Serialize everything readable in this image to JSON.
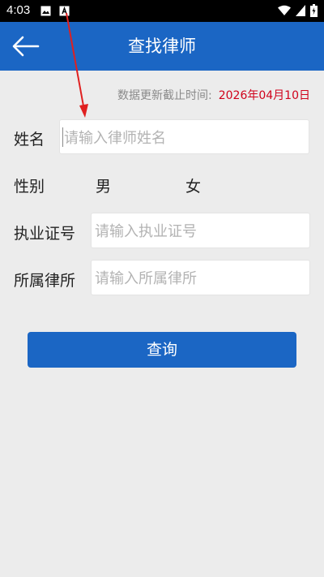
{
  "status_bar": {
    "time": "4:03",
    "icons": [
      "image-icon",
      "text-a-icon",
      "wifi-icon",
      "signal-icon",
      "battery-icon"
    ]
  },
  "app_bar": {
    "title": "查找律师",
    "back_icon": "back-arrow-icon",
    "color": "#1b66c4"
  },
  "update_info": {
    "label": "数据更新截止时间:",
    "date": "2026年04月10日",
    "date_color": "#d0021b"
  },
  "form": {
    "name": {
      "label": "姓名",
      "placeholder": "请输入律师姓名",
      "value": ""
    },
    "gender": {
      "label": "性别",
      "options": [
        "男",
        "女"
      ]
    },
    "license": {
      "label": "执业证号",
      "placeholder": "请输入执业证号",
      "value": ""
    },
    "firm": {
      "label": "所属律所",
      "placeholder": "请输入所属律所",
      "value": ""
    }
  },
  "query_button": {
    "label": "查询"
  }
}
